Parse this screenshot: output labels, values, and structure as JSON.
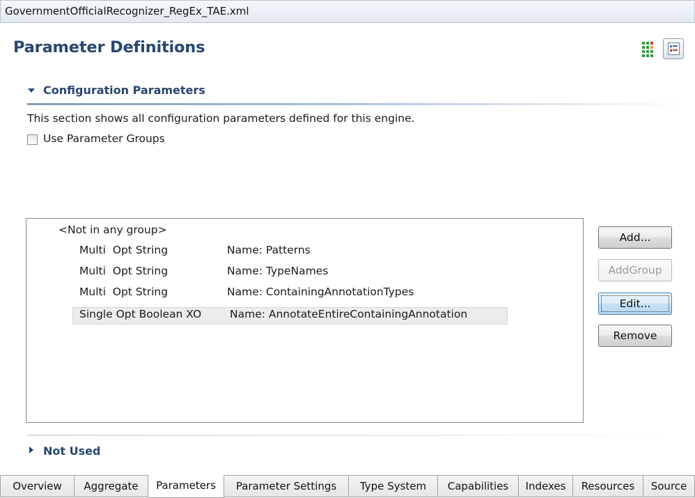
{
  "window": {
    "title": "GovernmentOfficialRecognizer_RegEx_TAE.xml"
  },
  "page": {
    "title": "Parameter Definitions"
  },
  "toolbar_icons": [
    "columns-layout-icon",
    "form-layout-icon"
  ],
  "config_section": {
    "title": "Configuration Parameters",
    "description": "This section shows all configuration parameters defined for this engine.",
    "use_groups_label": "Use Parameter Groups",
    "use_groups_checked": false
  },
  "tree": {
    "group_label": "<Not in any group>",
    "params": [
      {
        "kind": "Multi  Opt String",
        "name": "Name: Patterns",
        "selected": false
      },
      {
        "kind": "Multi  Opt String",
        "name": "Name: TypeNames",
        "selected": false
      },
      {
        "kind": "Multi  Opt String",
        "name": "Name: ContainingAnnotationTypes",
        "selected": false
      },
      {
        "kind": "Single Opt Boolean XO",
        "name": "Name: AnnotateEntireContainingAnnotation",
        "selected": true
      }
    ]
  },
  "buttons": {
    "add": "Add...",
    "add_group": "AddGroup",
    "edit": "Edit...",
    "remove": "Remove"
  },
  "not_used_section": {
    "title": "Not Used"
  },
  "tabs": [
    {
      "label": "Overview",
      "active": false
    },
    {
      "label": "Aggregate",
      "active": false
    },
    {
      "label": "Parameters",
      "active": true
    },
    {
      "label": "Parameter Settings",
      "active": false
    },
    {
      "label": "Type System",
      "active": false
    },
    {
      "label": "Capabilities",
      "active": false
    },
    {
      "label": "Indexes",
      "active": false
    },
    {
      "label": "Resources",
      "active": false
    },
    {
      "label": "Source",
      "active": false
    }
  ],
  "colors": {
    "heading": "#27476f",
    "selection": "#ececec",
    "focus_border": "#3c7fb1"
  }
}
